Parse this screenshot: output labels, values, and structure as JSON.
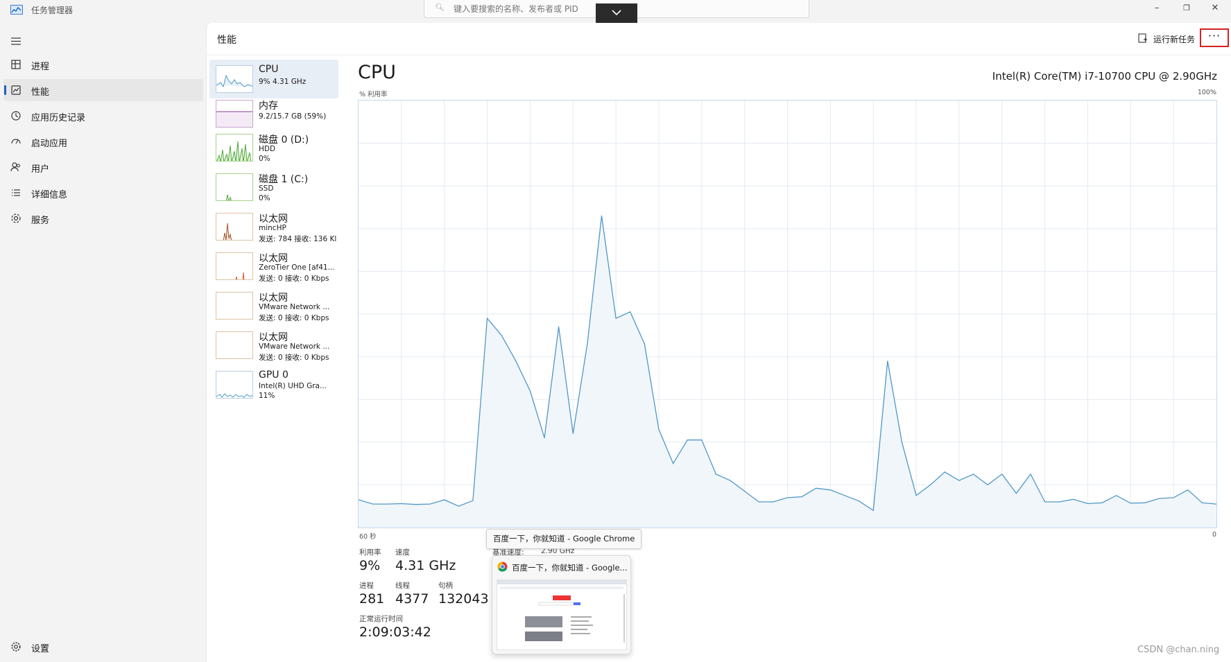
{
  "window": {
    "title": "任务管理器",
    "search_placeholder": "键入要搜索的名称、发布者或 PID",
    "controls": [
      "–",
      "❐",
      "✕"
    ]
  },
  "nav": {
    "items": [
      {
        "label": "进程",
        "icon": "process-icon",
        "active": false
      },
      {
        "label": "性能",
        "icon": "performance-icon",
        "active": true
      },
      {
        "label": "应用历史记录",
        "icon": "history-icon",
        "active": false
      },
      {
        "label": "启动应用",
        "icon": "startup-icon",
        "active": false
      },
      {
        "label": "用户",
        "icon": "users-icon",
        "active": false
      },
      {
        "label": "详细信息",
        "icon": "details-icon",
        "active": false
      },
      {
        "label": "服务",
        "icon": "services-icon",
        "active": false
      }
    ],
    "settings_label": "设置"
  },
  "header": {
    "title": "性能",
    "run_task_label": "运行新任务",
    "more_label": "···"
  },
  "resources": [
    {
      "name": "CPU",
      "lines": [
        "9% 4.31 GHz"
      ],
      "kind": "cpu"
    },
    {
      "name": "内存",
      "lines": [
        "9.2/15.7 GB (59%)"
      ],
      "kind": "mem"
    },
    {
      "name": "磁盘 0 (D:)",
      "lines": [
        "HDD",
        "0%"
      ],
      "kind": "disk0"
    },
    {
      "name": "磁盘 1 (C:)",
      "lines": [
        "SSD",
        "0%"
      ],
      "kind": "disk1"
    },
    {
      "name": "以太网",
      "lines": [
        "mincHP",
        "发送: 784 接收: 136 Kl"
      ],
      "kind": "net1"
    },
    {
      "name": "以太网",
      "lines": [
        "ZeroTier One [af41...",
        "发送: 0 接收: 0 Kbps"
      ],
      "kind": "net2"
    },
    {
      "name": "以太网",
      "lines": [
        "VMware Network ...",
        "发送: 0 接收: 0 Kbps"
      ],
      "kind": "net3"
    },
    {
      "name": "以太网",
      "lines": [
        "VMware Network ...",
        "发送: 0 接收: 0 Kbps"
      ],
      "kind": "net4"
    },
    {
      "name": "GPU 0",
      "lines": [
        "Intel(R) UHD Gra...",
        "11%"
      ],
      "kind": "gpu"
    }
  ],
  "detail": {
    "title": "CPU",
    "model": "Intel(R) Core(TM) i7-10700 CPU @ 2.90GHz",
    "y_label": "% 利用率",
    "y_max_label": "100%",
    "x_left_label": "60 秒",
    "x_right_label": "0",
    "stats": {
      "utilization_label": "利用率",
      "utilization_value": "9%",
      "speed_label": "速度",
      "speed_value": "4.31 GHz",
      "base_speed_label": "基准速度:",
      "base_speed_value": "2.90 GHz",
      "processes_label": "进程",
      "processes_value": "281",
      "threads_label": "线程",
      "threads_value": "4377",
      "handles_label": "句柄",
      "handles_value": "132043",
      "uptime_label": "正常运行时间",
      "uptime_value": "2:09:03:42"
    }
  },
  "tooltip": "百度一下，你就知道 - Google Chrome",
  "preview": {
    "title": "百度一下，你就知道 - Google...",
    "icon": "chrome-icon"
  },
  "watermark": "CSDN @chan.ning",
  "colors": {
    "cpu_line": "#4f98c6",
    "cpu_fill": "#f1f6fb",
    "mem_line": "#8b3f9c",
    "disk_line": "#4da73a",
    "net_line": "#a0522d",
    "accent": "#1e5fbf",
    "highlight_border": "#d42020"
  },
  "chart_data": {
    "type": "area",
    "title": "CPU",
    "ylabel": "% 利用率",
    "xlabel": "",
    "xlim": [
      60,
      0
    ],
    "ylim": [
      0,
      100
    ],
    "x": [
      60,
      59,
      58,
      57,
      56,
      55,
      54,
      53,
      52,
      51,
      50,
      49,
      48,
      47,
      46,
      45,
      44,
      43,
      42,
      41,
      40,
      39,
      38,
      37,
      36,
      35,
      34,
      33,
      32,
      31,
      30,
      29,
      28,
      27,
      26,
      25,
      24,
      23,
      22,
      21,
      20,
      19,
      18,
      17,
      16,
      15,
      14,
      13,
      12,
      11,
      10,
      9,
      8,
      7,
      6,
      5,
      4,
      3,
      2,
      1,
      0
    ],
    "series": [
      {
        "values": [
          6.5,
          5.5,
          5.5,
          5.6,
          5.4,
          5.5,
          6.5,
          5,
          6.3,
          49,
          45,
          39,
          32,
          21,
          47,
          22,
          43,
          73,
          49,
          50.5,
          43,
          23,
          15,
          20.5,
          20.5,
          12.5,
          11,
          8.5,
          6,
          6,
          7,
          7.2,
          9.2,
          8.8,
          7.5,
          6.2,
          4,
          39,
          20,
          7.5,
          10,
          13,
          11,
          12.5,
          10,
          12.5,
          8,
          12.5,
          6,
          6,
          6.6,
          5.6,
          5.8,
          7.5,
          5.7,
          5.8,
          6.8,
          7,
          8.8,
          5.8,
          5.5
        ]
      }
    ],
    "grid": true
  }
}
